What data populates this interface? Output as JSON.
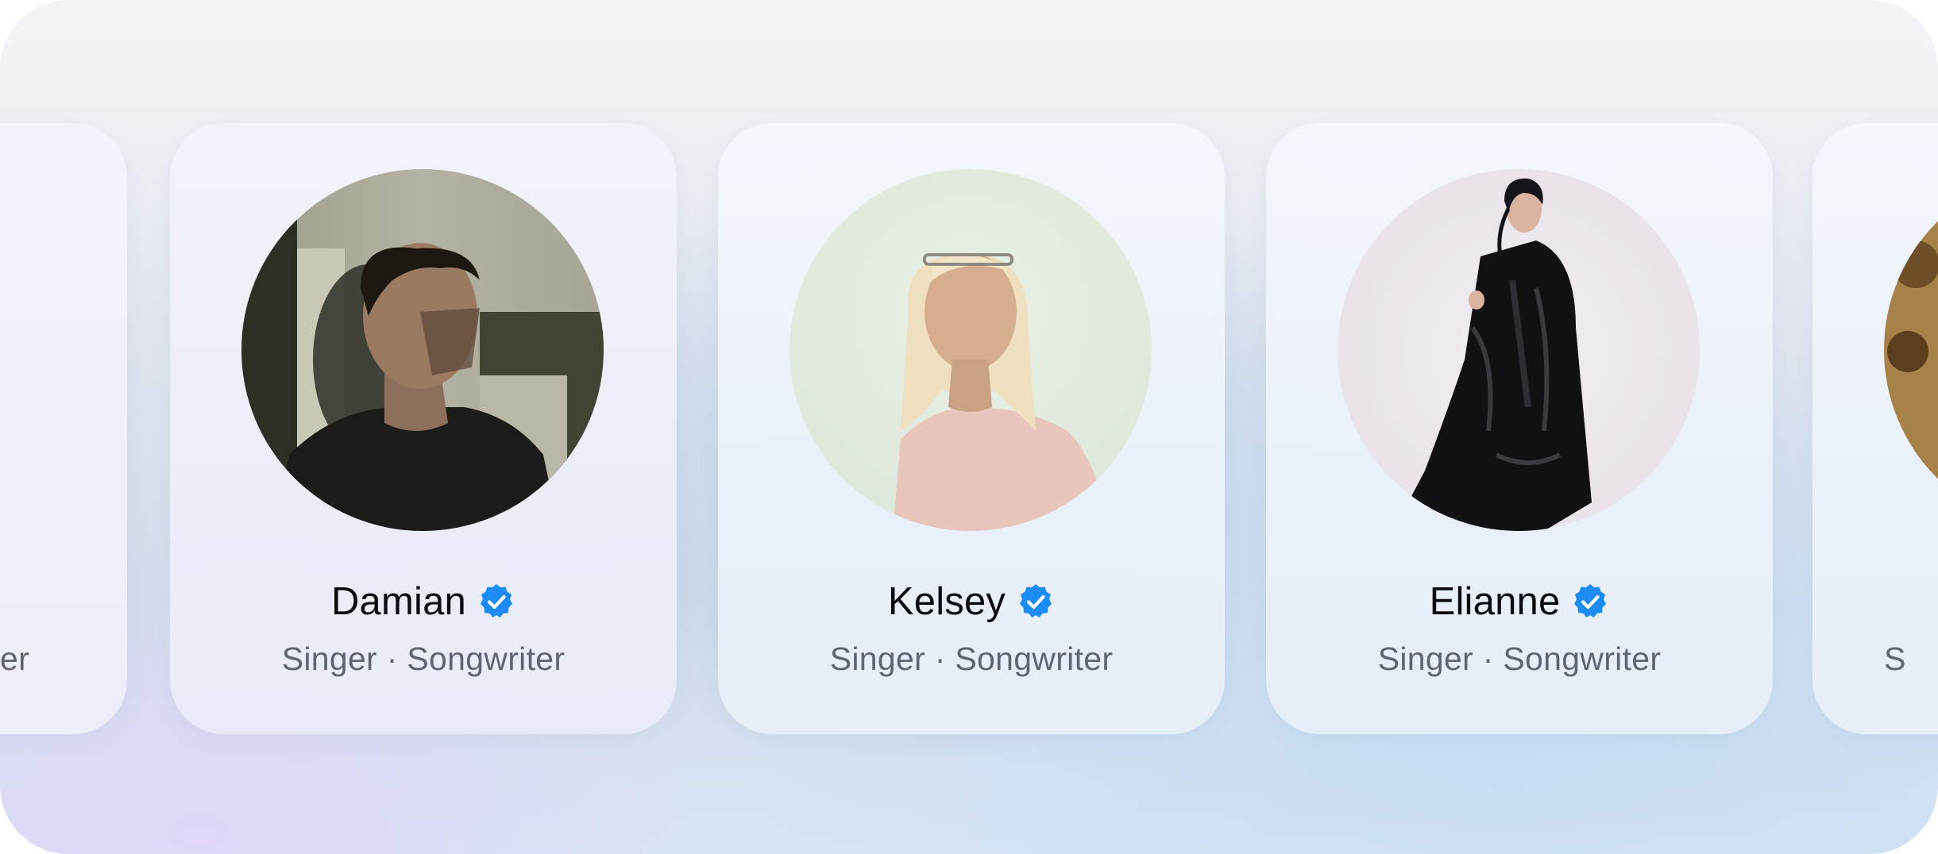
{
  "profiles": [
    {
      "name": "",
      "role": "er",
      "verified": false,
      "photo_icon": "cityscape-photo"
    },
    {
      "name": "Damian",
      "role": "Singer · Songwriter",
      "verified": true,
      "photo_icon": "man-portrait-photo"
    },
    {
      "name": "Kelsey",
      "role": "Singer · Songwriter",
      "verified": true,
      "photo_icon": "woman-portrait-photo"
    },
    {
      "name": "Elianne",
      "role": "Singer · Songwriter",
      "verified": true,
      "photo_icon": "woman-coat-portrait-photo"
    },
    {
      "name": "",
      "role": "S",
      "verified": false,
      "photo_icon": "floral-portrait-photo"
    }
  ],
  "colors": {
    "verified_badge": "#1d8bf4",
    "name_text": "#0b0b0f",
    "role_text": "#5e6472"
  },
  "icons": {
    "verified": "verified-badge-icon"
  }
}
